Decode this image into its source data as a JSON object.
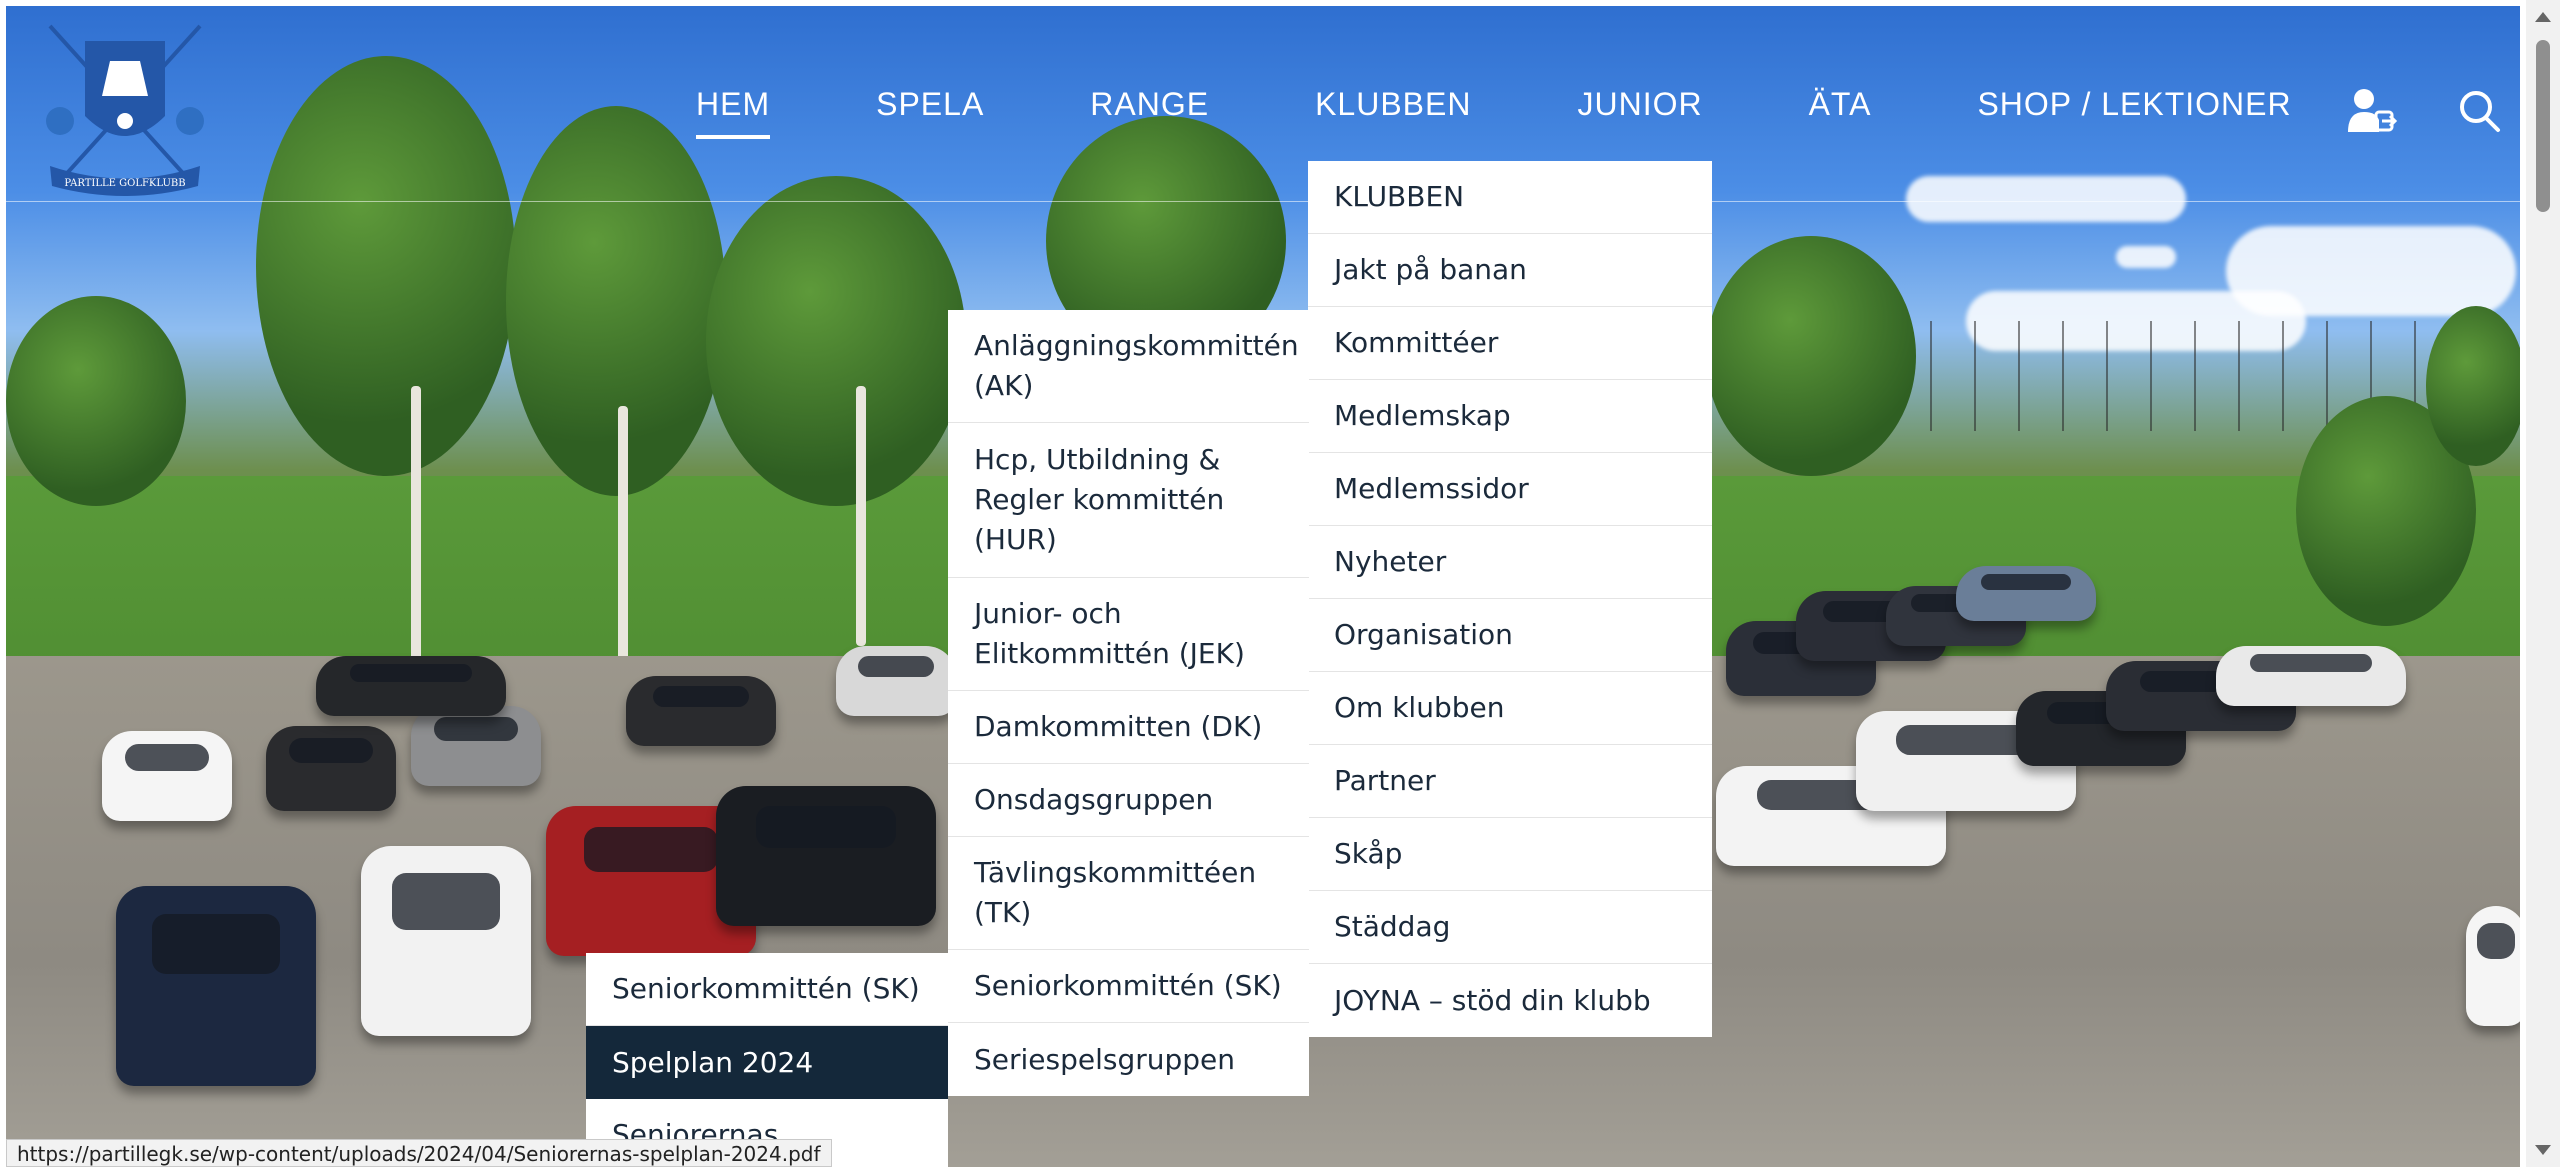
{
  "site": {
    "logo_label": "PARTILLE GOLFKLUBB"
  },
  "nav": {
    "items": [
      {
        "label": "HEM",
        "active": true
      },
      {
        "label": "SPELA",
        "active": false
      },
      {
        "label": "RANGE",
        "active": false
      },
      {
        "label": "KLUBBEN",
        "active": false
      },
      {
        "label": "JUNIOR",
        "active": false
      },
      {
        "label": "ÄTA",
        "active": false
      },
      {
        "label": "SHOP / LEKTIONER",
        "active": false
      }
    ],
    "login_icon": "user-login-icon",
    "search_icon": "search-icon"
  },
  "klubben_menu": {
    "items": [
      "KLUBBEN",
      "Jakt på banan",
      "Kommittéer",
      "Medlemskap",
      "Medlemssidor",
      "Nyheter",
      "Organisation",
      "Om klubben",
      "Partner",
      "Skåp",
      "Städdag",
      "JOYNA – stöd din klubb"
    ]
  },
  "kommitteer_menu": {
    "items": [
      {
        "lines": [
          "Anläggningskommittén",
          "(AK)"
        ]
      },
      {
        "lines": [
          "Hcp, Utbildning &",
          "Regler kommittén",
          "(HUR)"
        ]
      },
      {
        "lines": [
          "Junior- och",
          "Elitkommittén (JEK)"
        ]
      },
      {
        "lines": [
          "Damkommitten (DK)"
        ]
      },
      {
        "lines": [
          "Onsdagsgruppen"
        ]
      },
      {
        "lines": [
          "Tävlingskommittéen",
          "(TK)"
        ]
      },
      {
        "lines": [
          "Seniorkommittén (SK)"
        ]
      },
      {
        "lines": [
          "Seriespelsgruppen"
        ]
      }
    ]
  },
  "sk_menu": {
    "items": [
      {
        "label": "Seniorkommittén (SK)",
        "active": false
      },
      {
        "label": "Spelplan 2024",
        "active": true
      },
      {
        "label": "Seniorernas",
        "active": false
      }
    ]
  },
  "status_url": "https://partillegk.se/wp-content/uploads/2024/04/Seniorernas-spelplan-2024.pdf",
  "colors": {
    "menu_active_bg": "#14283a",
    "menu_text": "#1b2a3b",
    "nav_text": "#ffffff"
  }
}
